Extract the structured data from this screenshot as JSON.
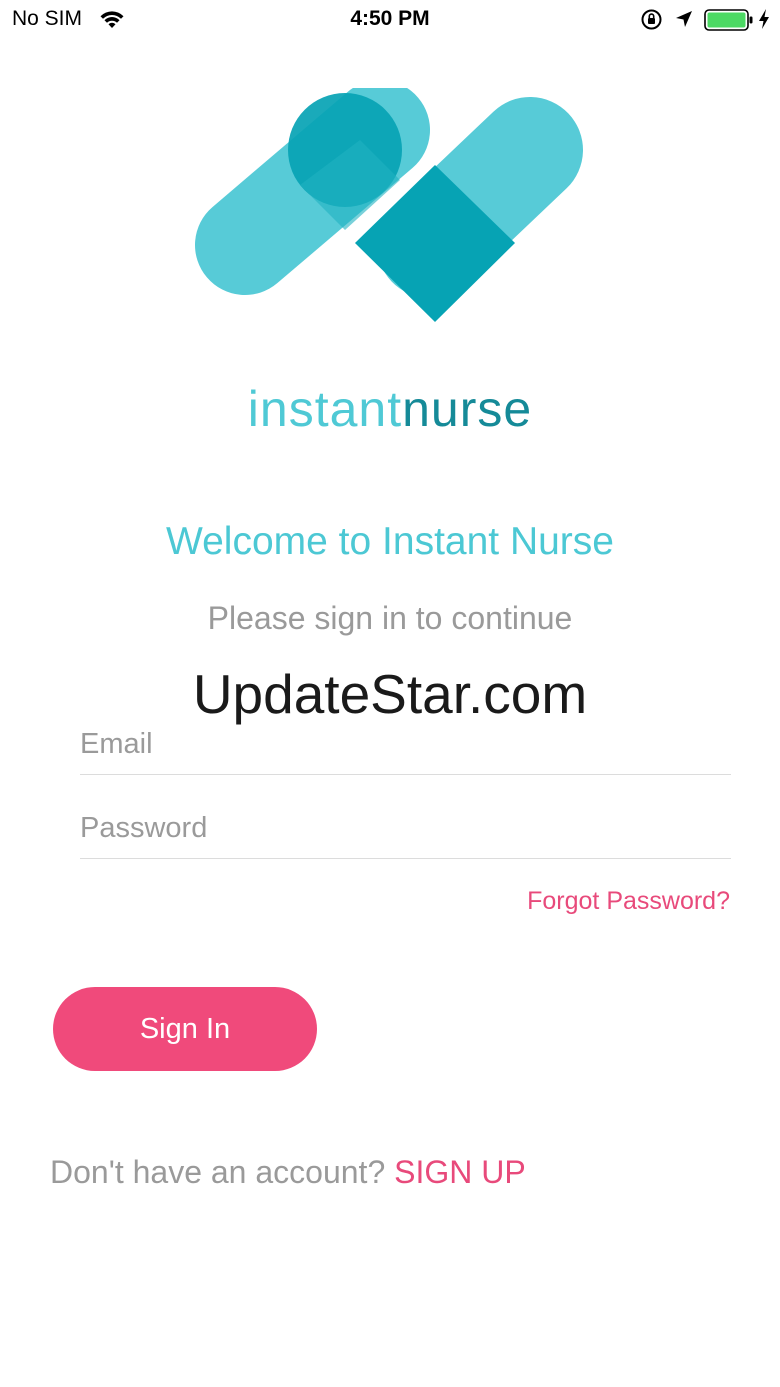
{
  "status_bar": {
    "carrier": "No SIM",
    "time": "4:50 PM",
    "icons": [
      "wifi-icon",
      "orientation-lock-icon",
      "location-icon",
      "battery-icon",
      "charging-bolt-icon"
    ],
    "battery_color": "#4cd964"
  },
  "logo": {
    "wordmark_part1": "instant",
    "wordmark_part2": "nurse",
    "colors": {
      "light": "#4fc9d5",
      "dark": "#06a3b4",
      "wordmark_dark": "#158a98"
    }
  },
  "welcome_title": "Welcome to Instant Nurse",
  "subtitle": "Please sign in to continue",
  "watermark": "UpdateStar.com",
  "form": {
    "email_placeholder": "Email",
    "email_value": "",
    "password_placeholder": "Password",
    "password_value": "",
    "forgot_password_label": "Forgot Password?",
    "sign_in_label": "Sign In"
  },
  "signup": {
    "prompt": "Don't have an account?",
    "link_label": "SIGN UP"
  },
  "colors": {
    "accent_pink": "#f04a7b",
    "accent_teal": "#4cc8d4",
    "muted_text": "#9a9a9a"
  }
}
